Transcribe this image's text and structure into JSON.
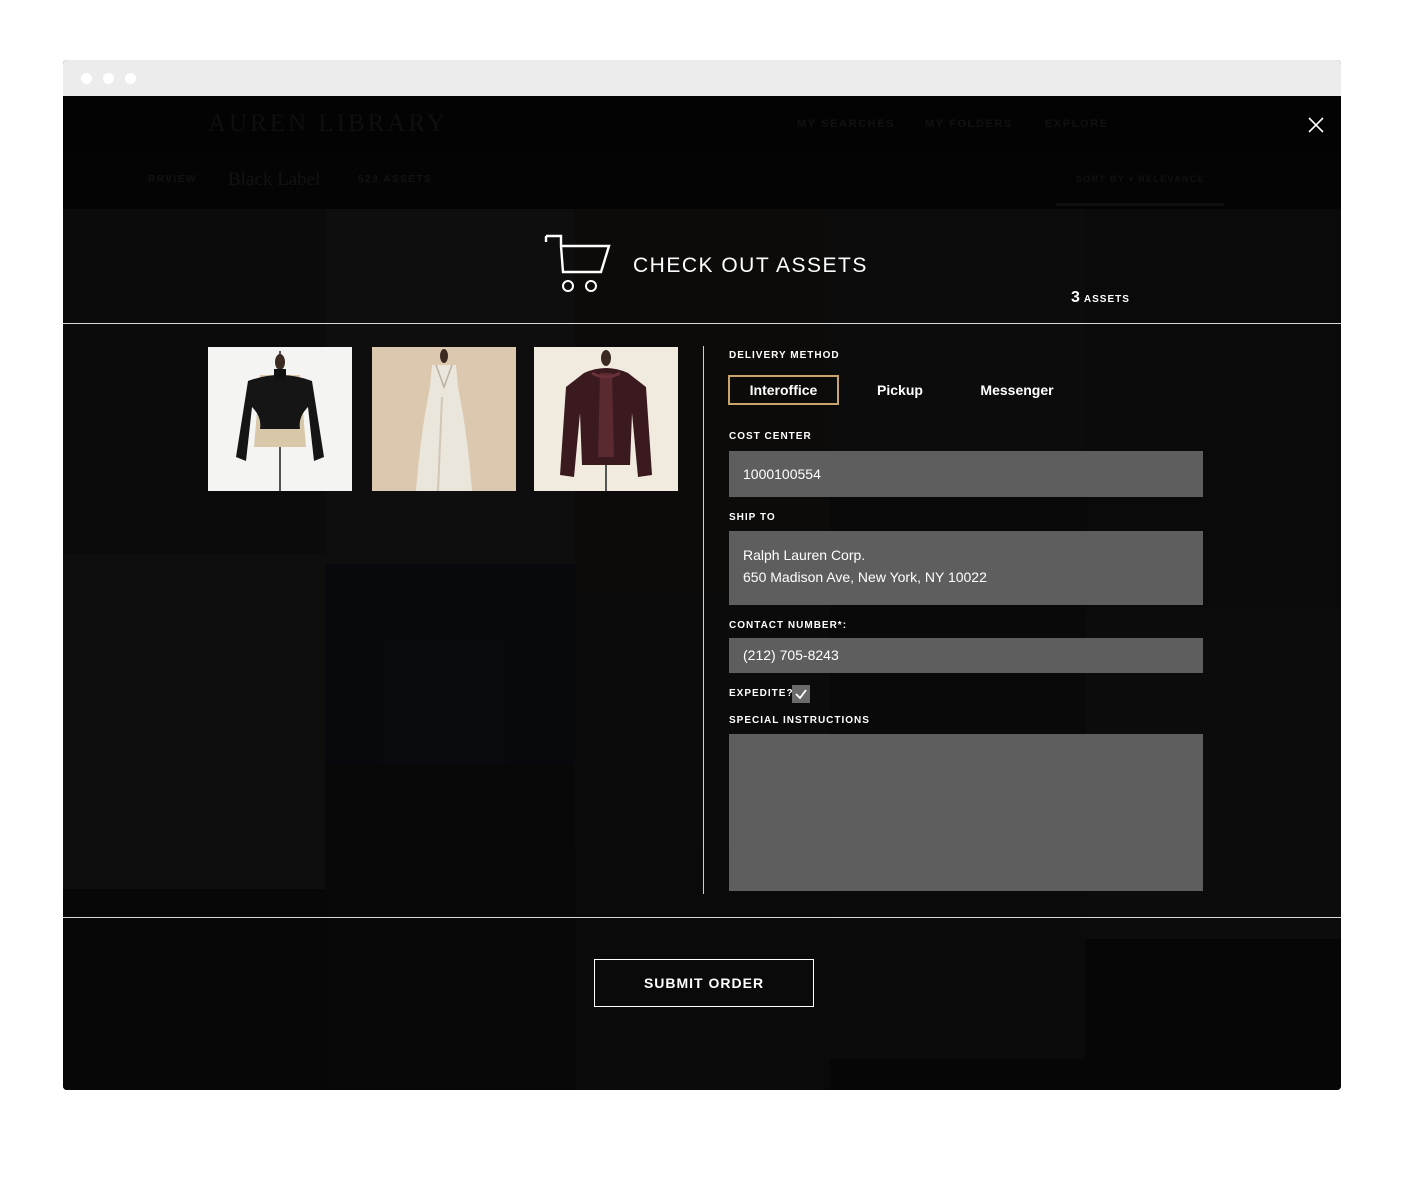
{
  "background": {
    "logo": "AUREN LIBRARY",
    "nav": [
      "MY SEARCHES",
      "MY FOLDERS",
      "EXPLORE"
    ],
    "breadcrumb_prefix": "RRVIEW",
    "breadcrumb_title": "Black Label",
    "breadcrumb_count": "523 ASSETS",
    "sort_label": "SORT BY  ▾  RELEVANCE"
  },
  "modal": {
    "title": "CHECK OUT ASSETS",
    "asset_count": "3",
    "asset_count_label": "ASSETS",
    "delivery_method_label": "DELIVERY METHOD",
    "delivery_options": [
      "Interoffice",
      "Pickup",
      "Messenger"
    ],
    "selected_delivery": "Interoffice",
    "cost_center_label": "COST CENTER",
    "cost_center_value": "1000100554",
    "ship_to_label": "SHIP TO",
    "ship_to_line1": "Ralph Lauren Corp.",
    "ship_to_line2": "650 Madison Ave, New York, NY 10022",
    "contact_label": "CONTACT NUMBER*:",
    "contact_value": "(212) 705-8243",
    "expedite_label": "EXPEDITE?",
    "expedite_checked": true,
    "special_instructions_label": "SPECIAL INSTRUCTIONS",
    "special_instructions_value": "",
    "submit_label": "SUBMIT ORDER"
  },
  "colors": {
    "accent_border": "#c9a46a",
    "field_bg": "#5e5e5e",
    "overlay": "#0b0b0b"
  },
  "icons": [
    "close-icon",
    "cart-icon",
    "checkmark-icon"
  ]
}
